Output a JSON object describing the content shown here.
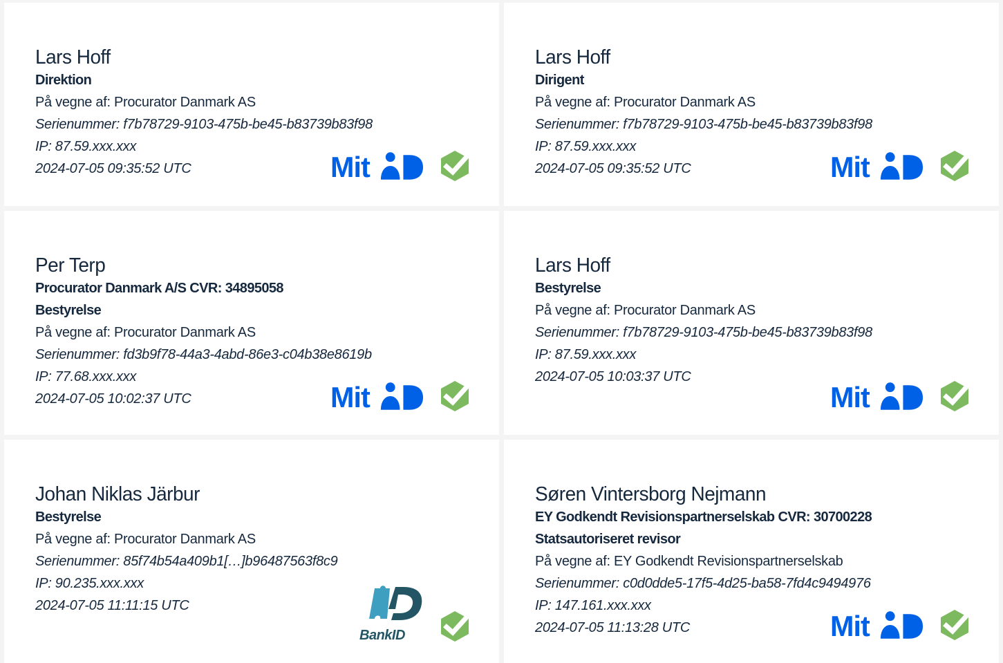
{
  "colors": {
    "text": "#16283d",
    "mitid_blue": "#0060e6",
    "check_green": "#7dba5f",
    "bankid_dark": "#235565",
    "bankid_light": "#3f9fc0"
  },
  "signatures": [
    {
      "name": "Lars Hoff",
      "company": "",
      "role": "Direktion",
      "on_behalf": "På vegne af: Procurator Danmark AS",
      "serial": "Serienummer: f7b78729-9103-475b-be45-b83739b83f98",
      "ip": "IP: 87.59.xxx.xxx",
      "timestamp": "2024-07-05 09:35:52 UTC",
      "provider_icon": "mitid-logo",
      "verified_icon": "check-badge-icon"
    },
    {
      "name": "Lars Hoff",
      "company": "",
      "role": "Dirigent",
      "on_behalf": "På vegne af: Procurator Danmark AS",
      "serial": "Serienummer: f7b78729-9103-475b-be45-b83739b83f98",
      "ip": "IP: 87.59.xxx.xxx",
      "timestamp": "2024-07-05 09:35:52 UTC",
      "provider_icon": "mitid-logo",
      "verified_icon": "check-badge-icon"
    },
    {
      "name": "Per Terp",
      "company": "Procurator Danmark A/S CVR: 34895058",
      "role": "Bestyrelse",
      "on_behalf": "På vegne af: Procurator Danmark AS",
      "serial": "Serienummer: fd3b9f78-44a3-4abd-86e3-c04b38e8619b",
      "ip": "IP: 77.68.xxx.xxx",
      "timestamp": "2024-07-05 10:02:37 UTC",
      "provider_icon": "mitid-logo",
      "verified_icon": "check-badge-icon"
    },
    {
      "name": "Lars Hoff",
      "company": "",
      "role": "Bestyrelse",
      "on_behalf": "På vegne af: Procurator Danmark AS",
      "serial": "Serienummer: f7b78729-9103-475b-be45-b83739b83f98",
      "ip": "IP: 87.59.xxx.xxx",
      "timestamp": "2024-07-05 10:03:37 UTC",
      "provider_icon": "mitid-logo",
      "verified_icon": "check-badge-icon"
    },
    {
      "name": "Johan Niklas Järbur",
      "company": "",
      "role": "Bestyrelse",
      "on_behalf": "På vegne af: Procurator Danmark AS",
      "serial": "Serienummer: 85f74b54a409b1[…]b96487563f8c9",
      "ip": "IP: 90.235.xxx.xxx",
      "timestamp": "2024-07-05 11:11:15 UTC",
      "provider_icon": "bankid-logo",
      "provider_text": "BankID",
      "verified_icon": "check-badge-icon"
    },
    {
      "name": "Søren Vintersborg Nejmann",
      "company": "EY Godkendt Revisionspartnerselskab CVR: 30700228",
      "role": "Statsautoriseret revisor",
      "on_behalf": "På vegne af: EY Godkendt Revisionspartnerselskab",
      "serial": "Serienummer: c0d0dde5-17f5-4d25-ba58-7fd4c9494976",
      "ip": "IP: 147.161.xxx.xxx",
      "timestamp": "2024-07-05 11:13:28 UTC",
      "provider_icon": "mitid-logo",
      "verified_icon": "check-badge-icon"
    }
  ]
}
